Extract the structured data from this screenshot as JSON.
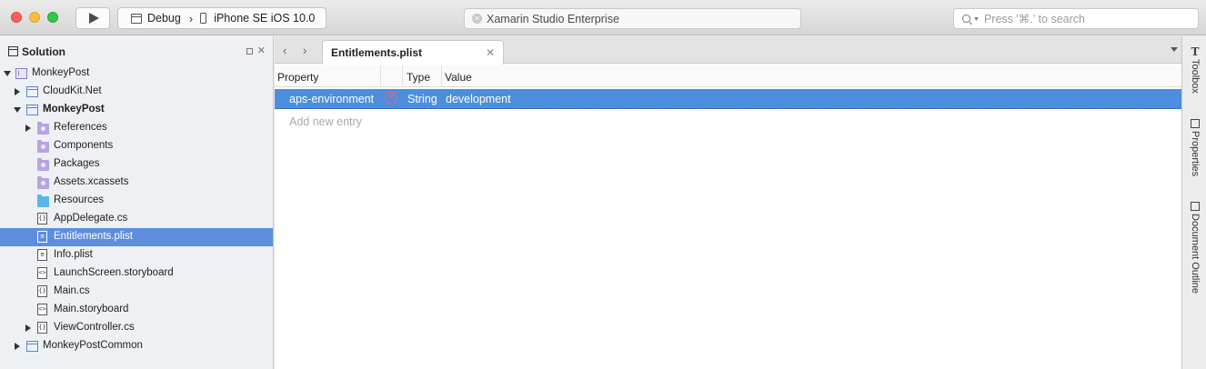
{
  "toolbar": {
    "config": "Debug",
    "device": "iPhone SE iOS 10.0",
    "status": "Xamarin Studio Enterprise",
    "search_placeholder": "Press '⌘.' to search"
  },
  "solution_pad": {
    "title": "Solution",
    "items": [
      {
        "label": "MonkeyPost"
      },
      {
        "label": "CloudKit.Net"
      },
      {
        "label": "MonkeyPost"
      },
      {
        "label": "References"
      },
      {
        "label": "Components"
      },
      {
        "label": "Packages"
      },
      {
        "label": "Assets.xcassets"
      },
      {
        "label": "Resources"
      },
      {
        "label": "AppDelegate.cs"
      },
      {
        "label": "Entitlements.plist"
      },
      {
        "label": "Info.plist"
      },
      {
        "label": "LaunchScreen.storyboard"
      },
      {
        "label": "Main.cs"
      },
      {
        "label": "Main.storyboard"
      },
      {
        "label": "ViewController.cs"
      },
      {
        "label": "MonkeyPostCommon"
      }
    ]
  },
  "editor": {
    "tab_title": "Entitlements.plist",
    "columns": [
      "Property",
      "Type",
      "Value"
    ],
    "rows": [
      {
        "property": "aps-environment",
        "type": "String",
        "value": "development"
      }
    ],
    "add_entry": "Add new entry"
  },
  "right_dock": {
    "items": [
      {
        "label": "Toolbox"
      },
      {
        "label": "Properties"
      },
      {
        "label": "Document Outline"
      }
    ]
  },
  "colors": {
    "selection": "#5d8ede",
    "row_selection": "#4b8ede"
  }
}
